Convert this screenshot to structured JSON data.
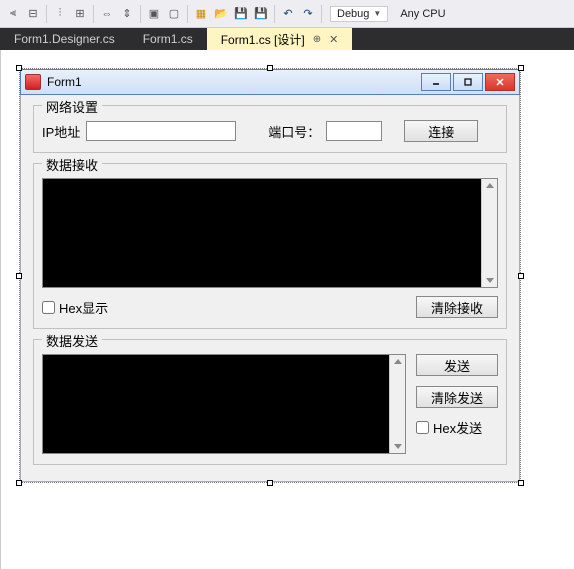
{
  "toolbar": {
    "config_debug": "Debug",
    "config_cpu": "Any CPU"
  },
  "tabs": {
    "designer_cs": "Form1.Designer.cs",
    "form_cs": "Form1.cs",
    "form_design": "Form1.cs [设计]"
  },
  "window": {
    "title": "Form1"
  },
  "net": {
    "legend": "网络设置",
    "ip_label": "IP地址",
    "ip_value": "",
    "port_label": "端口号：",
    "port_value": "",
    "connect_btn": "连接"
  },
  "recv": {
    "legend": "数据接收",
    "hex_label": "Hex显示",
    "clear_btn": "清除接收"
  },
  "send": {
    "legend": "数据发送",
    "send_btn": "发送",
    "clear_btn": "清除发送",
    "hex_label": "Hex发送"
  }
}
